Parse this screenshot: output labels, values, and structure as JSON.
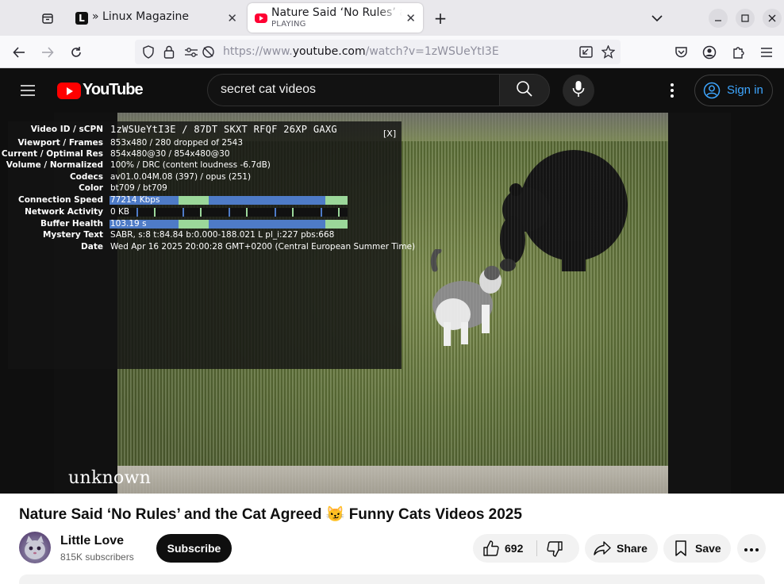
{
  "browser": {
    "tabs": [
      {
        "favicon": "L",
        "title": "» Linux Magazine",
        "active": false
      },
      {
        "favicon": "youtube-favicon",
        "title": "Nature Said ‘No Rules’ and the Cat Agreed",
        "subtitle": "PLAYING",
        "active": true
      }
    ],
    "url": {
      "prefix": "https://www.",
      "domain": "youtube.com",
      "path": "/watch?v=1zWSUeYtI3E"
    }
  },
  "youtube": {
    "logo_text": "YouTube",
    "search_query": "secret cat videos",
    "sign_in_label": "Sign in"
  },
  "player": {
    "caption": "unknown",
    "stats": {
      "close_label": "[X]",
      "rows": [
        {
          "label": "Video ID / sCPN",
          "value": "1zWSUeYtI3E / 87DT SKXT RFQF 26XP GAXG"
        },
        {
          "label": "Viewport / Frames",
          "value": "853x480 / 280 dropped of 2543"
        },
        {
          "label": "Current / Optimal Res",
          "value": "854x480@30 / 854x480@30"
        },
        {
          "label": "Volume / Normalized",
          "value": "100% / DRC (content loudness -6.7dB)"
        },
        {
          "label": "Codecs",
          "value": "av01.0.04M.08 (397) / opus (251)"
        },
        {
          "label": "Color",
          "value": "bt709 / bt709"
        },
        {
          "label": "Connection Speed",
          "value": "77214 Kbps"
        },
        {
          "label": "Network Activity",
          "value": "0 KB"
        },
        {
          "label": "Buffer Health",
          "value": "103.19 s"
        },
        {
          "label": "Mystery Text",
          "value": "SABR, s:8 t:84.84 b:0.000-188.021 L pl_i:227 pbs:668"
        },
        {
          "label": "Date",
          "value": "Wed Apr 16 2025 20:00:28 GMT+0200 (Central European Summer Time)"
        }
      ]
    }
  },
  "video": {
    "title": "Nature Said ‘No Rules’ and the Cat Agreed 😼 Funny Cats Videos 2025",
    "channel": "Little Love",
    "subscribers": "815K subscribers",
    "subscribe_label": "Subscribe",
    "likes": "692",
    "share_label": "Share",
    "save_label": "Save"
  },
  "colors": {
    "yt_red": "#ff0000",
    "link_blue": "#3ea6ff",
    "stats_green": "#9bd79a",
    "stats_blue": "#4e7bc7"
  }
}
